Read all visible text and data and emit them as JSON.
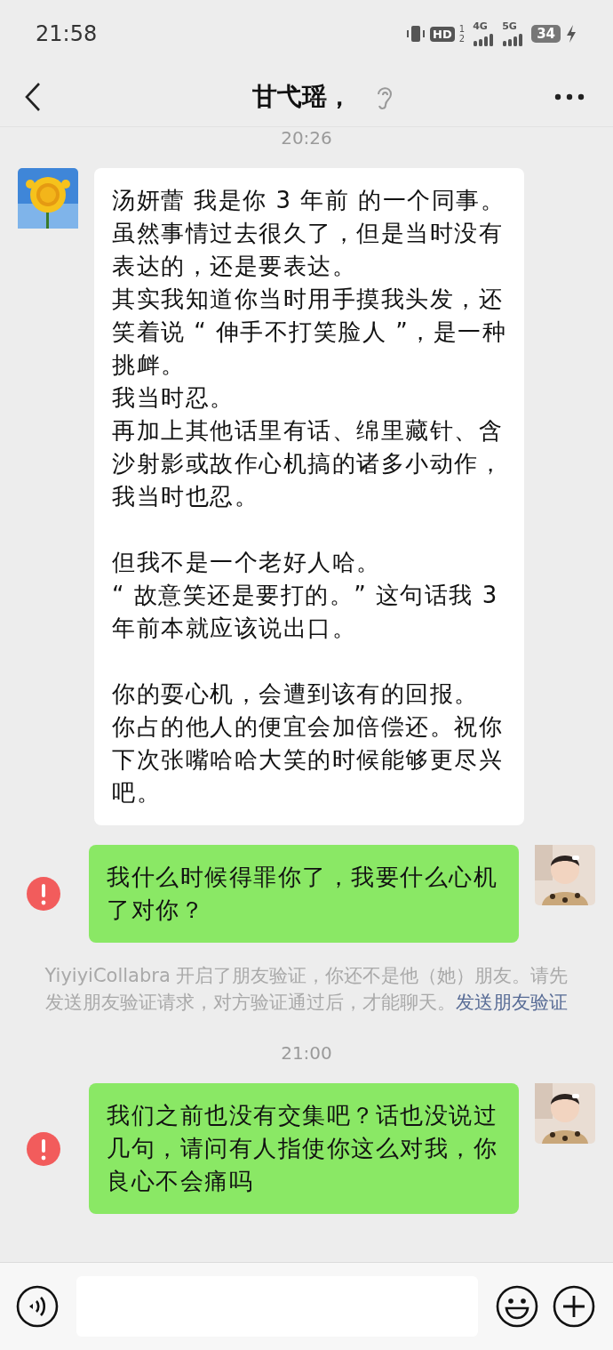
{
  "status_bar": {
    "time": "21:58",
    "hd": "HD",
    "hd_slots": [
      "1",
      "2"
    ],
    "networks": [
      "4G",
      "5G"
    ],
    "battery": "34",
    "charging": true
  },
  "header": {
    "title": "甘弋瑶，"
  },
  "messages": [
    {
      "kind": "time",
      "text": "20:26"
    },
    {
      "kind": "incoming",
      "blocks": [
        [
          "汤妍蕾 我是你 3 年前 的一个同事。虽然事情过去很久了，但是当时没有表达的，还是要表达。",
          "其实我知道你当时用手摸我头发，还笑着说 “ 伸手不打笑脸人 ”，是一种挑衅。",
          "我当时忍。",
          "再加上其他话里有话、绵里藏针、含沙射影或故作心机搞的诸多小动作，我当时也忍。"
        ],
        [
          "但我不是一个老好人哈。",
          "“ 故意笑还是要打的。” 这句话我 3 年前本就应该说出口。"
        ],
        [
          "你的耍心机，会遭到该有的回报。",
          "你占的他人的便宜会加倍偿还。祝你下次张嘴哈哈大笑的时候能够更尽兴吧。"
        ]
      ]
    },
    {
      "kind": "outgoing",
      "failed": true,
      "blocks": [
        [
          "我什么时候得罪你了，我要什么心机了对你？"
        ]
      ]
    },
    {
      "kind": "notice",
      "text": "YiyiyiCollabra 开启了朋友验证，你还不是他（她）朋友。请先发送朋友验证请求，对方验证通过后，才能聊天。",
      "link": "发送朋友验证"
    },
    {
      "kind": "time",
      "text": "21:00"
    },
    {
      "kind": "outgoing",
      "failed": true,
      "blocks": [
        [
          "我们之前也没有交集吧？话也没说过几句，请问有人指使你这么对我，你良心不会痛吗"
        ]
      ]
    }
  ]
}
